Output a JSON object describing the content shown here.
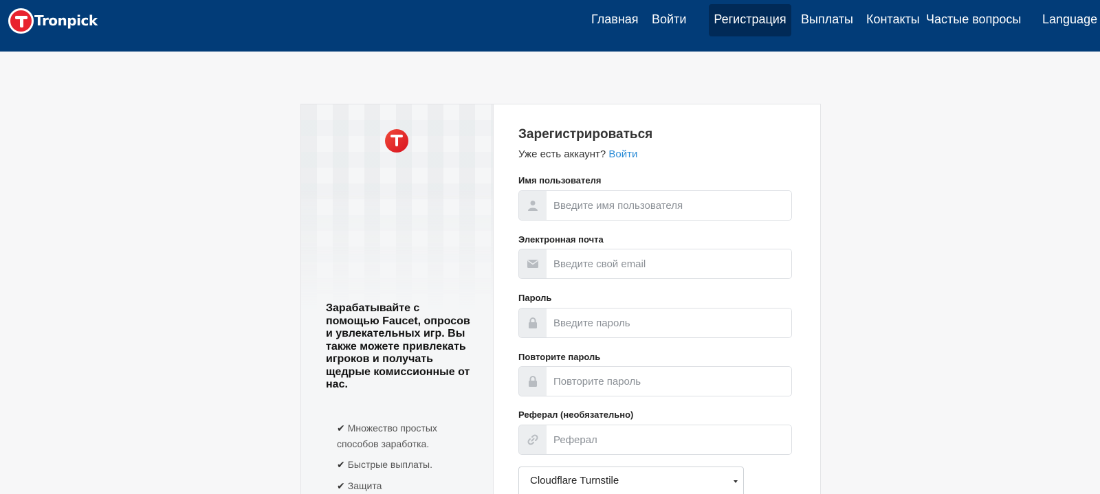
{
  "brand": {
    "name": "Tronpick"
  },
  "nav": {
    "items": [
      {
        "label": "Главная"
      },
      {
        "label": "Войти"
      },
      {
        "label": "Регистрация",
        "active": true
      },
      {
        "label": "Выплаты"
      },
      {
        "label": "Контакты"
      },
      {
        "label": "Частые вопросы"
      },
      {
        "label": "Language"
      }
    ]
  },
  "left": {
    "promo": "Зарабатывайте с помощью Faucet, опросов и увлекательных игр. Вы также можете привлекать игроков и получать щедрые комиссионные от нас.",
    "features": [
      "Множество простых способов заработка.",
      "Быстрые выплаты.",
      "Защита"
    ]
  },
  "form": {
    "title": "Зарегистрироваться",
    "have_account": "Уже есть аккаунт?",
    "login_link": "Войти",
    "fields": [
      {
        "label": "Имя пользователя",
        "placeholder": "Введите имя пользователя",
        "icon": "user-icon"
      },
      {
        "label": "Электронная почта",
        "placeholder": "Введите свой email",
        "icon": "envelope-icon"
      },
      {
        "label": "Пароль",
        "placeholder": "Введите пароль",
        "icon": "lock-icon"
      },
      {
        "label": "Повторите пароль",
        "placeholder": "Повторите пароль",
        "icon": "lock-icon"
      },
      {
        "label": "Реферал (необязательно)",
        "placeholder": "Реферал",
        "icon": "link-icon"
      }
    ],
    "captcha_select": "Cloudflare Turnstile"
  },
  "colors": {
    "navbar": "#023c78",
    "nav_active": "#012a57",
    "brand_red": "#e8232f",
    "link": "#2a8bd6"
  }
}
